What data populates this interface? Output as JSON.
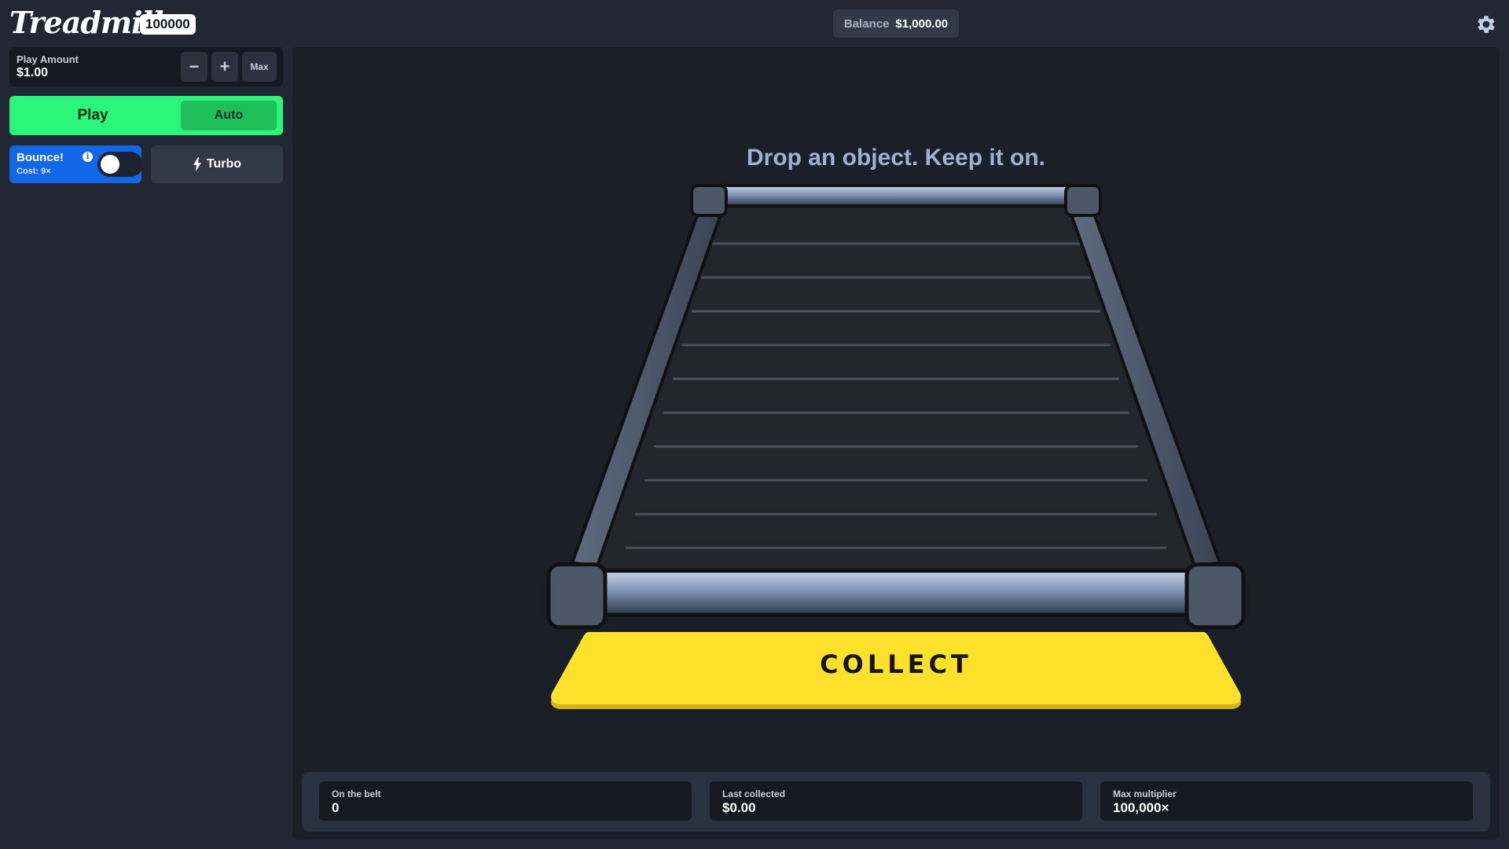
{
  "header": {
    "logo": "Treadmill",
    "logo_badge": "100000",
    "balance_label": "Balance",
    "balance_value": "$1,000.00",
    "settings_icon": "gear-icon"
  },
  "sidebar": {
    "play_amount_label": "Play Amount",
    "play_amount_value": "$1.00",
    "decrease_label": "−",
    "increase_label": "+",
    "max_label": "Max",
    "play_label": "Play",
    "auto_label": "Auto",
    "bounce_label": "Bounce!",
    "bounce_info": "i",
    "bounce_cost": "Cost: 9×",
    "turbo_label": "Turbo",
    "turbo_icon": "lightning-icon"
  },
  "main": {
    "tagline": "Drop an object. Keep it on.",
    "collect_label": "COLLECT"
  },
  "stats": [
    {
      "label": "On the belt",
      "value": "0"
    },
    {
      "label": "Last collected",
      "value": "$0.00"
    },
    {
      "label": "Max multiplier",
      "value": "100,000×"
    }
  ],
  "colors": {
    "background": "#222833",
    "play_green": "#2cf57c",
    "auto_green": "#1fbf5b",
    "bounce_blue": "#1167e8",
    "collect_yellow": "#ffe12b"
  }
}
